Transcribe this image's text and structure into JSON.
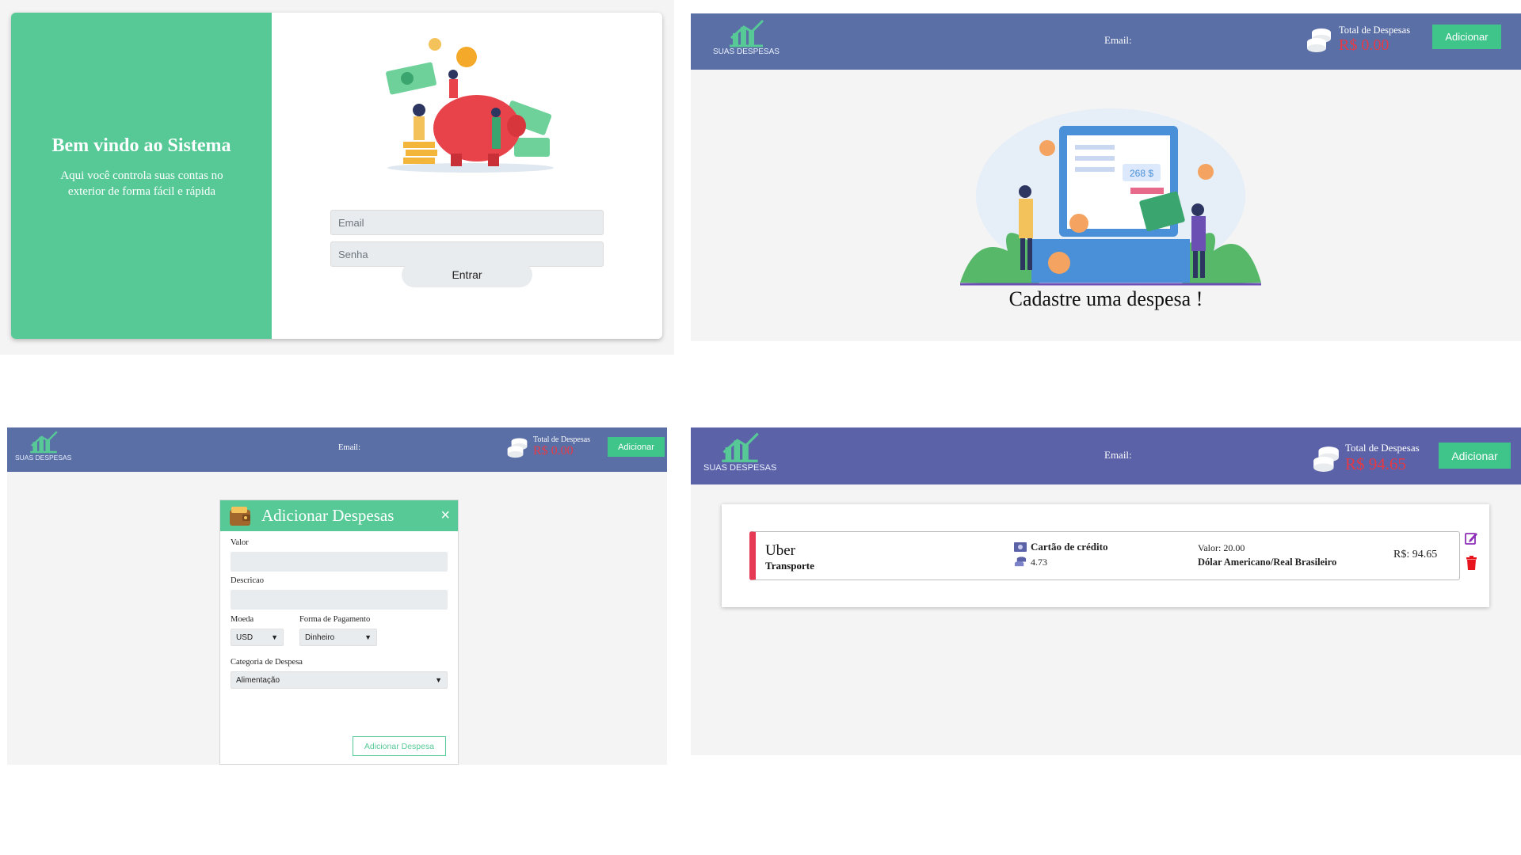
{
  "colors": {
    "brand_green": "#57c997",
    "header_blue": "#5a6fa6",
    "header_purple": "#5b62a8",
    "total_red": "#e63946",
    "add_green": "#3fc48a"
  },
  "login": {
    "welcome_title": "Bem vindo ao Sistema",
    "welcome_text": "Aqui você controla suas contas no exterior de forma fácil e rápida",
    "email_placeholder": "Email",
    "password_placeholder": "Senha",
    "submit_label": "Entrar"
  },
  "empty_state": {
    "header": {
      "logo_text": "SUAS DESPESAS",
      "email_label": "Email:",
      "total_label": "Total de Despesas",
      "total_value": "R$ 0.00",
      "add_label": "Adicionar"
    },
    "caption": "Cadastre uma despesa !"
  },
  "add_expense": {
    "header": {
      "logo_text": "SUAS DESPESAS",
      "email_label": "Email:",
      "total_label": "Total de Despesas",
      "total_value": "R$ 0.00",
      "add_label": "Adicionar"
    },
    "modal": {
      "title": "Adicionar Despesas",
      "close_icon": "×",
      "valor_label": "Valor",
      "descricao_label": "Descricao",
      "moeda_label": "Moeda",
      "moeda_value": "USD",
      "pagamento_label": "Forma de Pagamento",
      "pagamento_value": "Dinheiro",
      "categoria_label": "Categoria de Despesa",
      "categoria_value": "Alimentação",
      "submit_label": "Adicionar Despesa"
    }
  },
  "expense_list": {
    "header": {
      "logo_text": "SUAS DESPESAS",
      "email_label": "Email:",
      "total_label": "Total de Despesas",
      "total_value": "R$ 94.65",
      "add_label": "Adicionar"
    },
    "items": [
      {
        "description": "Uber",
        "category": "Transporte",
        "payment": "Cartão de crédito",
        "rate": "4.73",
        "valor": "Valor: 20.00",
        "currency_name": "Dólar Americano/Real Brasileiro",
        "converted": "R$: 94.65"
      }
    ]
  }
}
